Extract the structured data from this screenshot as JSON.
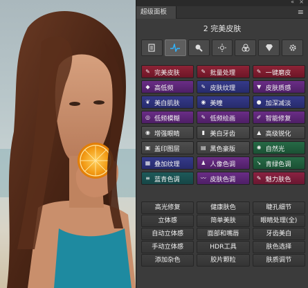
{
  "panel": {
    "tab_title": "超级面板",
    "heading": "2 完美皮肤",
    "tabs": [
      {
        "icon": "document-icon"
      },
      {
        "icon": "pulse-icon",
        "active": true
      },
      {
        "icon": "magnifier-icon"
      },
      {
        "icon": "sun-icon"
      },
      {
        "icon": "color-circles-icon"
      },
      {
        "icon": "diamond-icon"
      },
      {
        "icon": "gear-icon"
      }
    ]
  },
  "functions": [
    {
      "label": "完美皮肤",
      "color": "red",
      "icon": "brush-icon"
    },
    {
      "label": "批量处理",
      "color": "red",
      "icon": "brush-icon"
    },
    {
      "label": "一键磨皮",
      "color": "red",
      "icon": "brush-icon"
    },
    {
      "label": "高低频",
      "color": "purple",
      "icon": "diamond-icon"
    },
    {
      "label": "皮肤纹理",
      "color": "blue",
      "icon": "brush-icon"
    },
    {
      "label": "皮肤质感",
      "color": "purple",
      "icon": "pin-icon"
    },
    {
      "label": "美白肌肤",
      "color": "blue",
      "icon": "feather-icon"
    },
    {
      "label": "美瞳",
      "color": "blue",
      "icon": "eye-icon"
    },
    {
      "label": "加深减淡",
      "color": "blue",
      "icon": "blob-icon"
    },
    {
      "label": "低频模糊",
      "color": "purple",
      "icon": "blur-icon"
    },
    {
      "label": "低频绘画",
      "color": "purple",
      "icon": "brush-icon"
    },
    {
      "label": "智能修复",
      "color": "purple",
      "icon": "pencil-icon"
    },
    {
      "label": "增强眼睛",
      "color": "gray",
      "icon": "eye-icon"
    },
    {
      "label": "美白牙齿",
      "color": "gray",
      "icon": "tooth-icon"
    },
    {
      "label": "高级锐化",
      "color": "gray",
      "icon": "triangle-icon"
    },
    {
      "label": "盖印图层",
      "color": "gray",
      "icon": "stamp-icon"
    },
    {
      "label": "黑色豪版",
      "color": "gray",
      "icon": "layers-icon"
    },
    {
      "label": "自然光",
      "color": "green",
      "icon": "light-icon"
    },
    {
      "label": "叠加纹理",
      "color": "blue",
      "icon": "pattern-icon"
    },
    {
      "label": "人像色调",
      "color": "purple",
      "icon": "figure-icon"
    },
    {
      "label": "青绿色调",
      "color": "green",
      "icon": "arrow-icon"
    },
    {
      "label": "蓝青色调",
      "color": "teal",
      "icon": "sliders-icon"
    },
    {
      "label": "皮肤色调",
      "color": "purple",
      "icon": "wave-icon"
    },
    {
      "label": "魅力肤色",
      "color": "rosered",
      "icon": "brush-icon"
    }
  ],
  "text_buttons": [
    "高光修复",
    "健康肤色",
    "睫孔细节",
    "立体感",
    "简单美肤",
    "眼睛处理(全)",
    "自动立体感",
    "面部和嘴唇",
    "牙齿美白",
    "手动立体感",
    "HDR工具",
    "肤色选择",
    "添加杂色",
    "胶片颗粒",
    "肤质调节"
  ],
  "colors": {
    "red": "#8e2336",
    "purple": "#6a2d86",
    "blue": "#353a8a",
    "gray": "#4e4e4e",
    "green": "#266a46",
    "teal": "#1e5a5a",
    "rosered": "#8a2242",
    "accent": "#2fb4ff"
  }
}
